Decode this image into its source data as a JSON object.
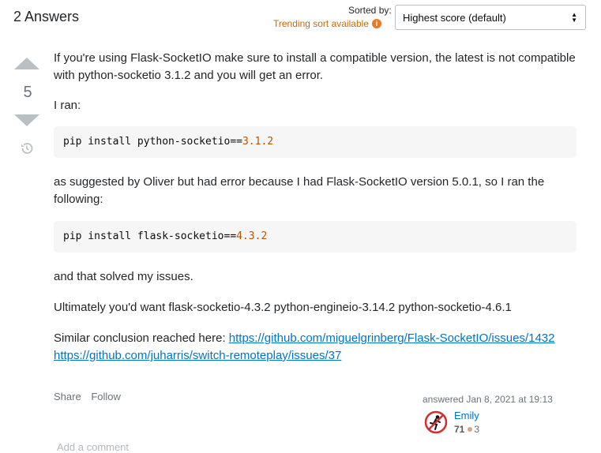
{
  "header": {
    "answers_count": "2 Answers",
    "sorted_by_label": "Sorted by:",
    "trending_text": "Trending sort available",
    "info_icon_glyph": "i",
    "sort_selected": "Highest score (default)"
  },
  "vote": {
    "score": "5"
  },
  "post": {
    "p1": "If you're using Flask-SocketIO make sure to install a compatible version, the latest is not compatible with python-socketio 3.1.2 and you will get an error.",
    "p2": "I ran:",
    "code1_cmd": "pip install python-socketio==",
    "code1_ver": "3.1.2",
    "p3": "as suggested by Oliver but had error because I had Flask-SocketIO version 5.0.1, so I ran the following:",
    "code2_cmd": "pip install flask-socketio==",
    "code2_ver": "4.3.2",
    "p4": "and that solved my issues.",
    "p5": "Ultimately you'd want flask-socketio-4.3.2 python-engineio-3.14.2 python-socketio-4.6.1",
    "p6_prefix": "Similar conclusion reached here: ",
    "link1": "https://github.com/miguelgrinberg/Flask-SocketIO/issues/1432",
    "link2": "https://github.com/juharris/switch-remoteplay/issues/37"
  },
  "footer": {
    "share": "Share",
    "follow": "Follow",
    "answered": "answered Jan 8, 2021 at 19:13",
    "user_name": "Emily",
    "reputation": "71",
    "bronze_badges": "3",
    "add_comment": "Add a comment"
  },
  "icons": {
    "vote_up": "caret-up-icon",
    "vote_down": "caret-down-icon",
    "history": "history-icon",
    "info": "info-icon",
    "sort_arrows": "sort-arrows-icon"
  },
  "colors": {
    "link": "#0074cc",
    "trending": "#c66b0f",
    "code_bg": "#f6f6f6",
    "code_number": "#b75301",
    "vote_arrow": "#babfc4"
  }
}
